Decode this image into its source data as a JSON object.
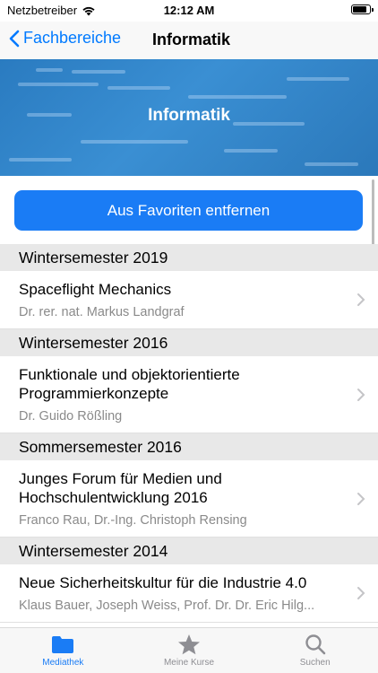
{
  "status": {
    "carrier": "Netzbetreiber",
    "time": "12:12 AM",
    "battery_level": 0.9
  },
  "navbar": {
    "back_label": "Fachbereiche",
    "title": "Informatik"
  },
  "hero": {
    "title": "Informatik"
  },
  "favorite_button": {
    "label": "Aus Favoriten entfernen"
  },
  "sections": [
    {
      "header": "Wintersemester 2019",
      "rows": [
        {
          "title": "Spaceflight Mechanics",
          "subtitle": "Dr. rer. nat. Markus Landgraf"
        }
      ]
    },
    {
      "header": "Wintersemester 2016",
      "rows": [
        {
          "title": "Funktionale und objektorientierte Programmierkonzepte",
          "subtitle": "Dr. Guido Rößling"
        }
      ]
    },
    {
      "header": "Sommersemester 2016",
      "rows": [
        {
          "title": "Junges Forum für Medien und Hochschulentwicklung 2016",
          "subtitle": "Franco Rau, Dr.-Ing. Christoph Rensing"
        }
      ]
    },
    {
      "header": "Wintersemester 2014",
      "rows": [
        {
          "title": "Neue Sicherheitskultur für die Industrie 4.0",
          "subtitle": "Klaus Bauer, Joseph Weiss, Prof. Dr. Dr. Eric Hilg..."
        }
      ]
    }
  ],
  "tabs": [
    {
      "label": "Mediathek",
      "icon": "folder-icon",
      "active": true
    },
    {
      "label": "Meine Kurse",
      "icon": "star-icon",
      "active": false
    },
    {
      "label": "Suchen",
      "icon": "magnifier-icon",
      "active": false
    }
  ],
  "colors": {
    "accent": "#007aff",
    "button": "#1a7cf5",
    "hero": "#2f84c8"
  }
}
